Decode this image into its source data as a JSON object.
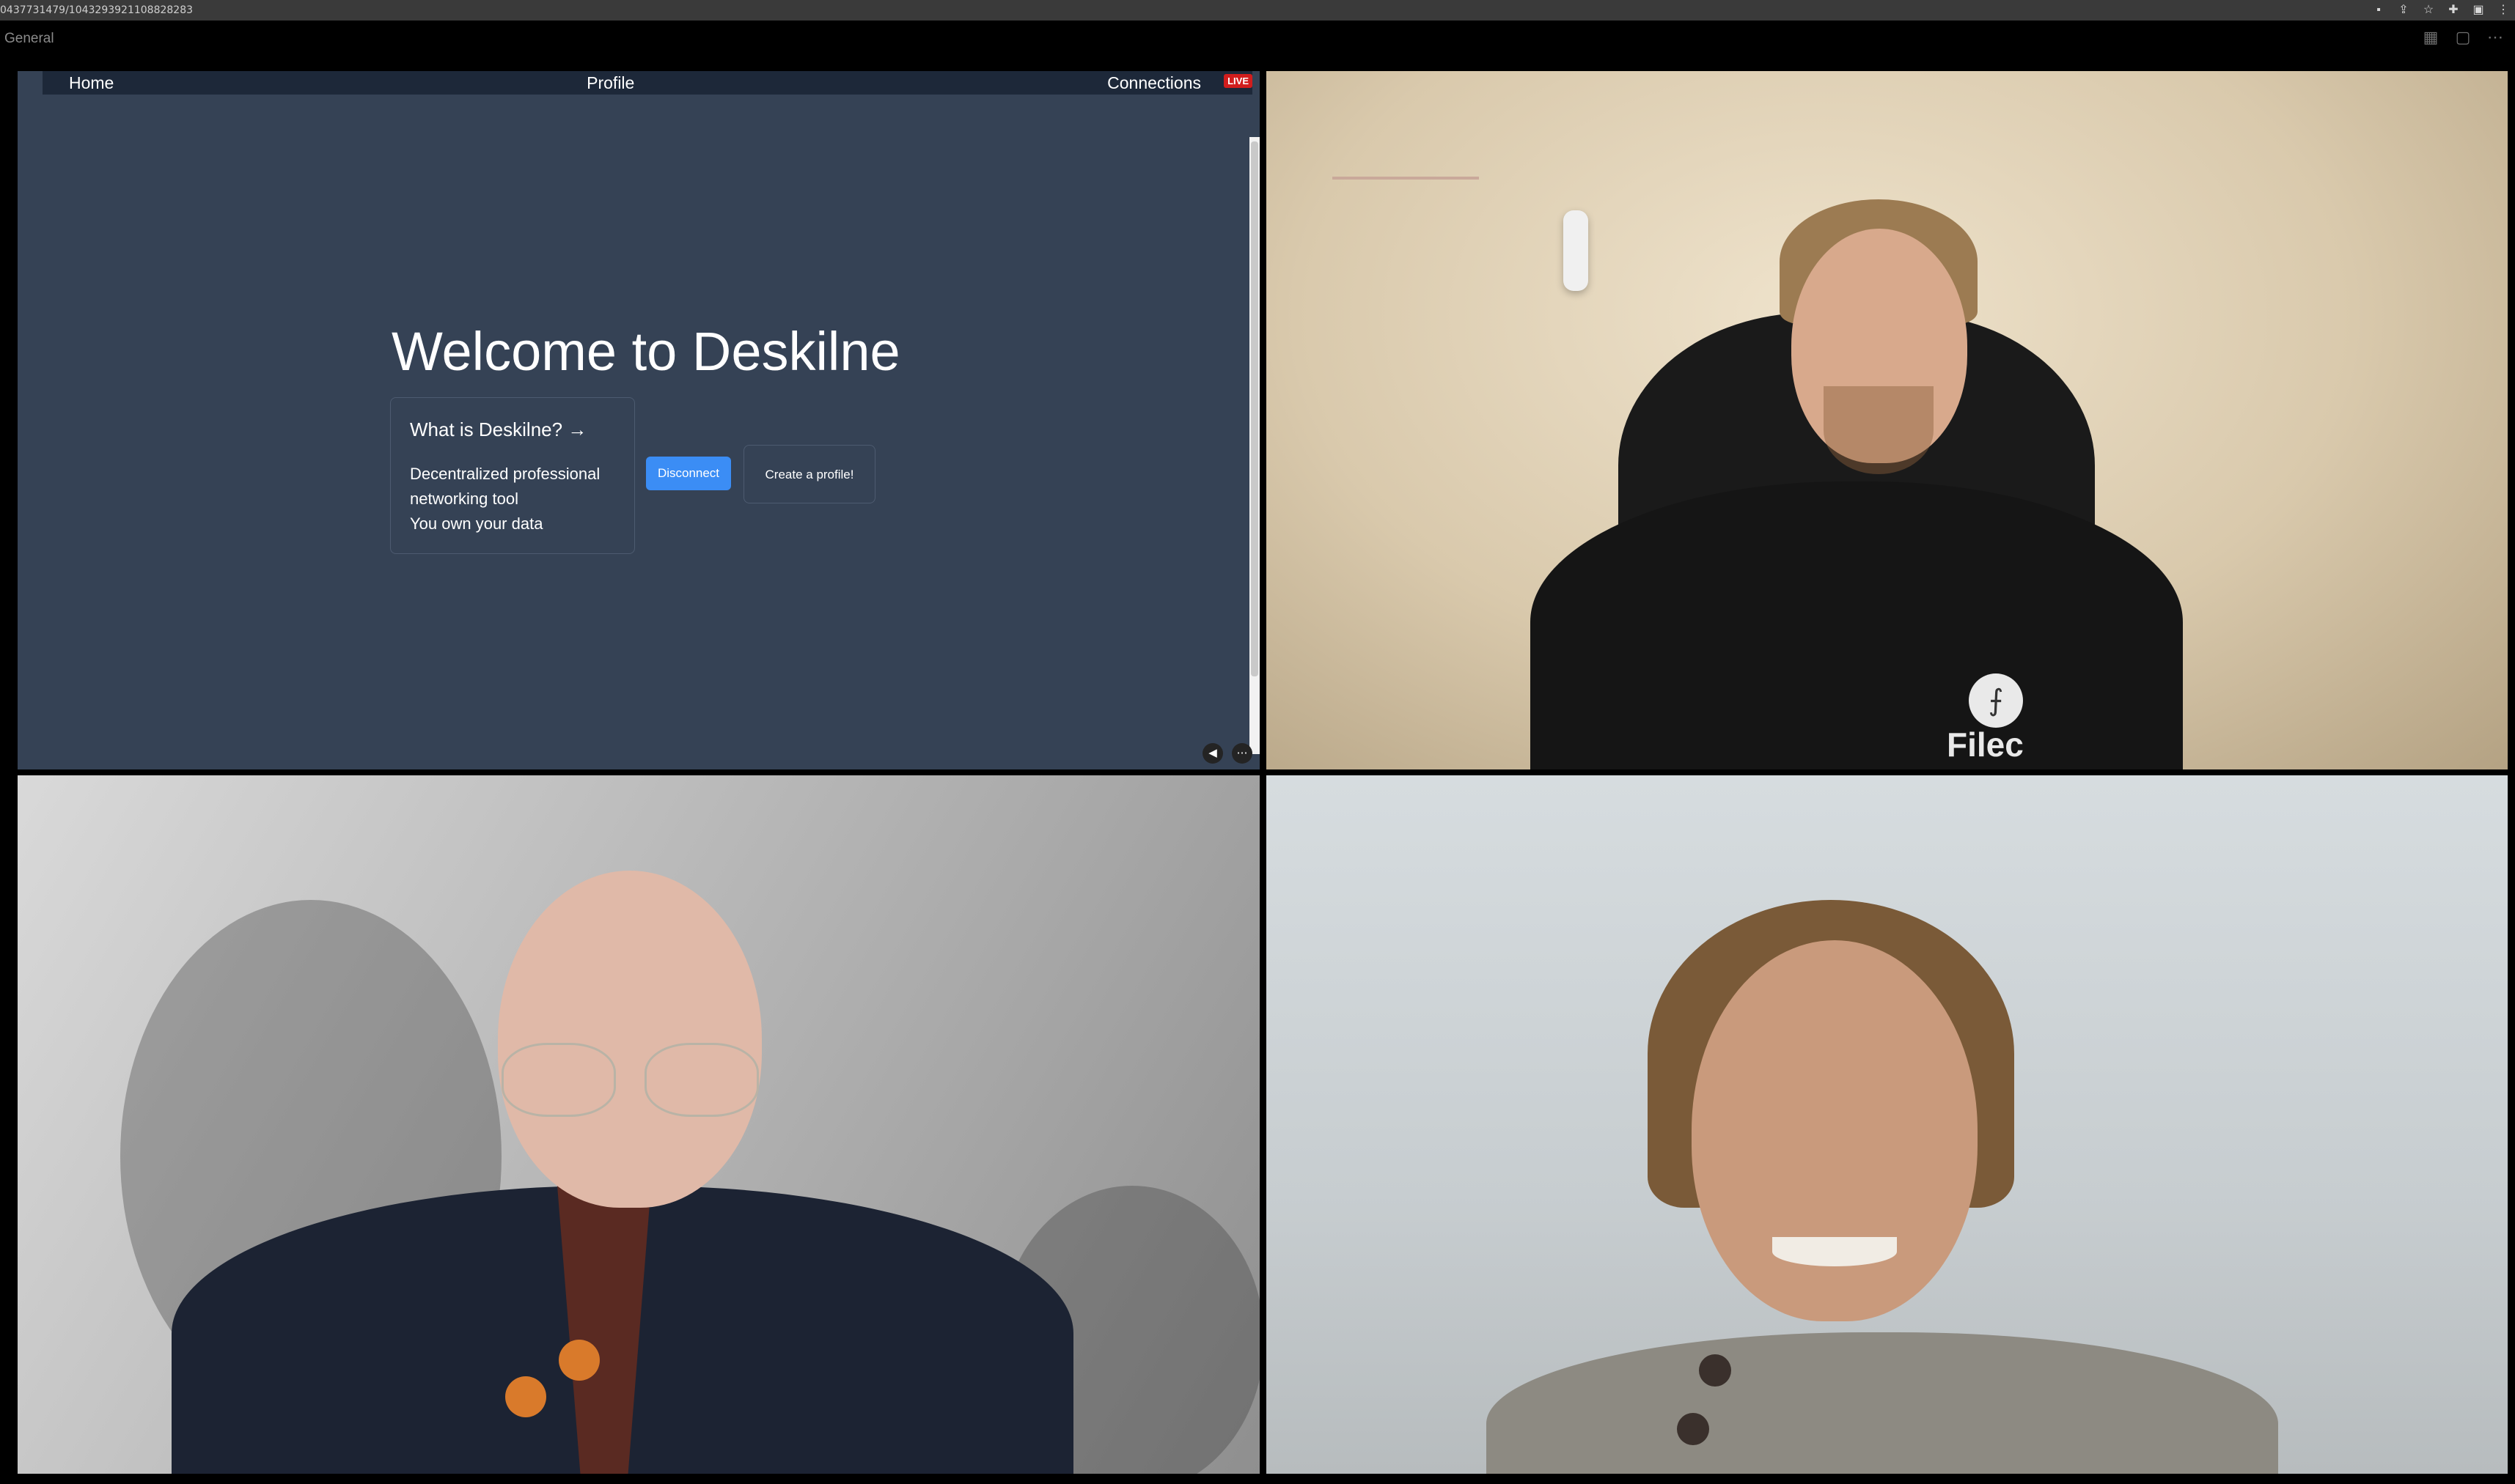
{
  "browser": {
    "url": "0437731479/1043293921108828283",
    "icons": [
      "camera-icon",
      "share-icon",
      "star-icon",
      "puzzle-icon",
      "window-icon",
      "more-icon"
    ]
  },
  "meeting": {
    "channel_title": "General",
    "icons": [
      "grid-layout-icon",
      "spotlight-layout-icon",
      "more-options-icon"
    ]
  },
  "shared_screen": {
    "nav": {
      "home": "Home",
      "profile": "Profile",
      "connections": "Connections"
    },
    "live_badge": "LIVE",
    "heading": "Welcome to Deskilne",
    "card": {
      "title": "What is Deskilne? →",
      "lines": [
        "Decentralized professional",
        "networking tool",
        "You own your data"
      ]
    },
    "disconnect_label": "Disconnect",
    "create_profile_label": "Create a profile!"
  },
  "participant_1": {
    "logo_text": "Filec"
  }
}
